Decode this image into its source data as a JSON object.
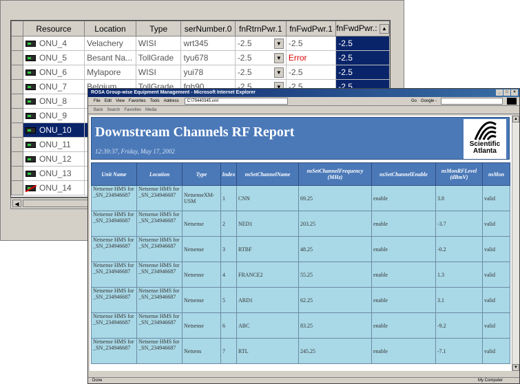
{
  "grid": {
    "columns": [
      "Resource",
      "Location",
      "Type",
      "serNumber.0",
      "fnRtrnPwr.1",
      "fnFwdPwr.1",
      "fnFwdPwr.:"
    ],
    "rows": [
      {
        "resource": "ONU_4",
        "location": "Velachery",
        "type": "WISI",
        "serial": "wrt345",
        "rtrn": "-2.5",
        "fwd1": "-2.5",
        "fwd2": "-2.5",
        "error": false,
        "selected": false
      },
      {
        "resource": "ONU_5",
        "location": "Besant Na...",
        "type": "TollGrade",
        "serial": "tyu678",
        "rtrn": "-2.5",
        "fwd1": "Error",
        "fwd2": "-2.5",
        "error": false,
        "selected": false
      },
      {
        "resource": "ONU_6",
        "location": "Mylapore",
        "type": "WISI",
        "serial": "yui78",
        "rtrn": "-2.5",
        "fwd1": "-2.5",
        "fwd2": "-2.5",
        "error": false,
        "selected": false
      },
      {
        "resource": "ONU_7",
        "location": "Belgium",
        "type": "TollGrade",
        "serial": "fgh90",
        "rtrn": "-2.5",
        "fwd1": "-2.5",
        "fwd2": "-2.5",
        "error": false,
        "selected": false
      },
      {
        "resource": "ONU_8",
        "location": "",
        "type": "",
        "serial": "",
        "rtrn": "",
        "fwd1": "",
        "fwd2": "",
        "error": false,
        "selected": false
      },
      {
        "resource": "ONU_9",
        "location": "",
        "type": "",
        "serial": "",
        "rtrn": "",
        "fwd1": "",
        "fwd2": "",
        "error": false,
        "selected": false
      },
      {
        "resource": "ONU_10",
        "location": "",
        "type": "",
        "serial": "",
        "rtrn": "",
        "fwd1": "",
        "fwd2": "",
        "error": false,
        "selected": true
      },
      {
        "resource": "ONU_11",
        "location": "",
        "type": "",
        "serial": "",
        "rtrn": "",
        "fwd1": "",
        "fwd2": "",
        "error": false,
        "selected": false
      },
      {
        "resource": "ONU_12",
        "location": "",
        "type": "",
        "serial": "",
        "rtrn": "",
        "fwd1": "",
        "fwd2": "",
        "error": false,
        "selected": false
      },
      {
        "resource": "ONU_13",
        "location": "",
        "type": "",
        "serial": "",
        "rtrn": "",
        "fwd1": "",
        "fwd2": "",
        "error": false,
        "selected": false
      },
      {
        "resource": "ONU_14",
        "location": "",
        "type": "",
        "serial": "",
        "rtrn": "",
        "fwd1": "",
        "fwd2": "",
        "error": true,
        "selected": false
      }
    ]
  },
  "browser": {
    "title": "ROSA Group-wise Equipment Management - Microsoft Internet Explorer",
    "menu": [
      "File",
      "Edit",
      "View",
      "Favorites",
      "Tools"
    ],
    "address_label": "Address",
    "address": "C:\\79440345.xml",
    "go": "Go",
    "google": "Google -",
    "toolbar": [
      "Back",
      "Search",
      "Favorites",
      "Media"
    ],
    "status_left": "Done",
    "status_right": "My Computer"
  },
  "report": {
    "title": "Downstream Channels RF Report",
    "timestamp": "12:39:37, Friday, May 17, 2002",
    "logo_line1": "Scientific",
    "logo_line2": "Atlanta",
    "columns": [
      "Unit Name",
      "Location",
      "Type",
      "Index",
      "nsSetChannelName",
      "nsSetChannelFrequency (MHz)",
      "nsSetChannelEnable",
      "nsMonRFLevel (dBmV)",
      "nsMon"
    ],
    "rows": [
      {
        "unit": "Netsense HMS for _SN_234946687",
        "location": "Netsense HMS for _SN_234946687",
        "type": "NetsenseXM-USM",
        "index": "1",
        "name": "CNN",
        "freq": "69.25",
        "enable": "enable",
        "level": "3.8",
        "mon": "valid"
      },
      {
        "unit": "Netsense HMS for _SN_234946687",
        "location": "Netsense HMS for _SN_234946687",
        "type": "Netsense",
        "index": "2",
        "name": "NED1",
        "freq": "203.25",
        "enable": "enable",
        "level": "-3.7",
        "mon": "valid"
      },
      {
        "unit": "Netsense HMS for _SN_234946687",
        "location": "Netsense HMS for _SN_234946687",
        "type": "Netsense",
        "index": "3",
        "name": "RTBF",
        "freq": "48.25",
        "enable": "enable",
        "level": "-0.2",
        "mon": "valid"
      },
      {
        "unit": "Netsense HMS for _SN_234946687",
        "location": "Netsense HMS for _SN_234946687",
        "type": "Netsense",
        "index": "4",
        "name": "FRANCE2",
        "freq": "55.25",
        "enable": "enable",
        "level": "1.3",
        "mon": "valid"
      },
      {
        "unit": "Netsense HMS for _SN_234946687",
        "location": "Netsense HMS for _SN_234946687",
        "type": "Netsense",
        "index": "5",
        "name": "ARD1",
        "freq": "62.25",
        "enable": "enable",
        "level": "3.1",
        "mon": "valid"
      },
      {
        "unit": "Netsense HMS for _SN_234946687",
        "location": "Netsense HMS for _SN_234946687",
        "type": "Netsense",
        "index": "6",
        "name": "ABC",
        "freq": "83.25",
        "enable": "enable",
        "level": "-9.2",
        "mon": "valid"
      },
      {
        "unit": "Netsense HMS for _SN_234946687",
        "location": "Netsense HMS for _SN_234946687",
        "type": "Netsens",
        "index": "7",
        "name": "RTL",
        "freq": "245.25",
        "enable": "enable",
        "level": "-7.1",
        "mon": "valid"
      }
    ]
  },
  "colors": {
    "selection": "#0a246a",
    "report_header": "#4b79b8",
    "report_cell": "#a9d8e6",
    "error": "#dd0000"
  }
}
